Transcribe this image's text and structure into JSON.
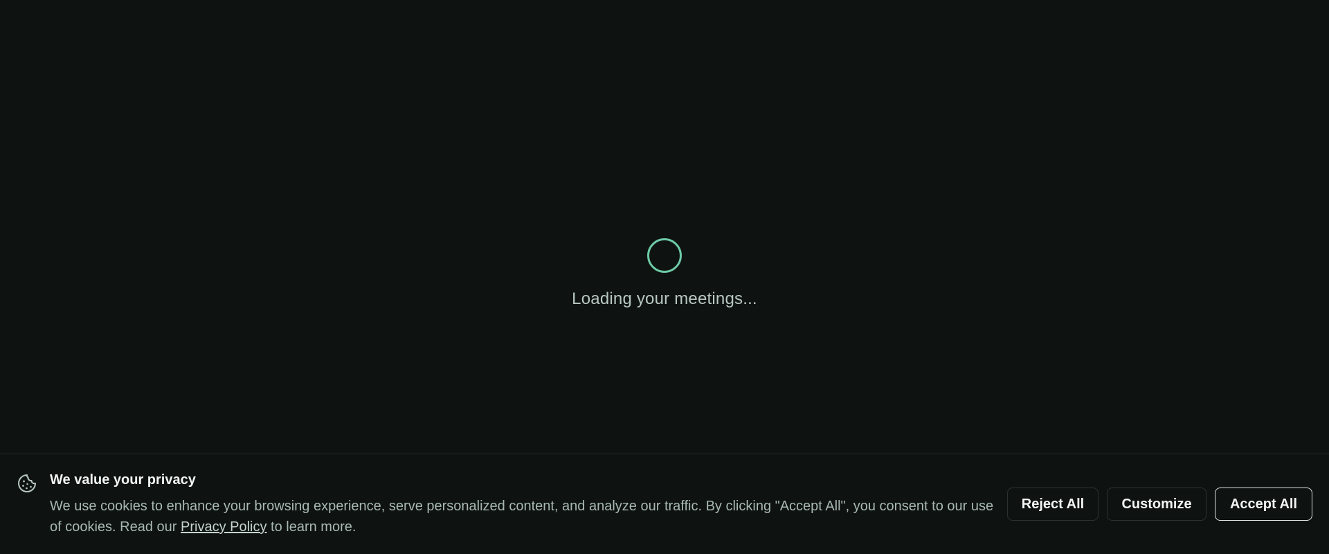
{
  "loader": {
    "text": "Loading your meetings..."
  },
  "cookie_banner": {
    "icon": "cookie-icon",
    "title": "We value your privacy",
    "text_before_link": "We use cookies to enhance your browsing experience, serve personalized content, and analyze our traffic. By clicking \"Accept All\", you consent to our use of cookies. Read our ",
    "link_text": "Privacy Policy",
    "text_after_link": " to learn more.",
    "buttons": {
      "reject": "Reject All",
      "customize": "Customize",
      "accept": "Accept All"
    }
  },
  "colors": {
    "background": "#0e1312",
    "accent": "#6ccaa6",
    "muted_text": "#a9b8b2"
  }
}
